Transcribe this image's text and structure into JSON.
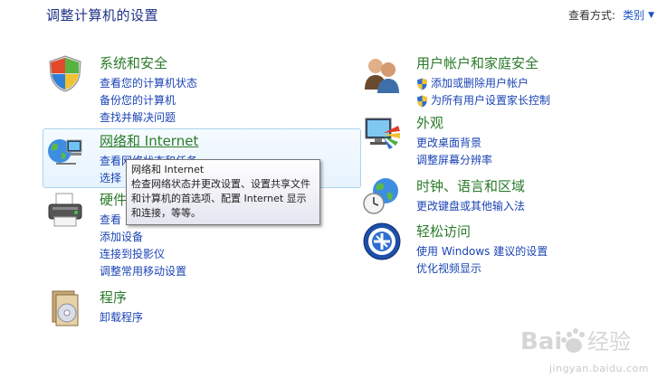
{
  "header": {
    "title": "调整计算机的设置",
    "view_by_label": "查看方式:",
    "view_by_value": "类别"
  },
  "categories": {
    "system": {
      "title": "系统和安全",
      "icon": "shield-windows-icon",
      "links": [
        "查看您的计算机状态",
        "备份您的计算机",
        "查找并解决问题"
      ]
    },
    "network": {
      "title": "网络和 Internet",
      "icon": "network-globe-icon",
      "links": [
        "查看网络状态和任务",
        "选择"
      ]
    },
    "hardware": {
      "title": "硬件",
      "icon": "printer-icon",
      "links": [
        "查看",
        "添加设备",
        "连接到投影仪",
        "调整常用移动设置"
      ]
    },
    "programs": {
      "title": "程序",
      "icon": "programs-disc-icon",
      "links": [
        "卸载程序"
      ]
    },
    "users": {
      "title": "用户帐户和家庭安全",
      "icon": "users-icon",
      "links": [
        "添加或删除用户帐户",
        "为所有用户设置家长控制"
      ]
    },
    "appearance": {
      "title": "外观",
      "icon": "monitor-palette-icon",
      "links": [
        "更改桌面背景",
        "调整屏幕分辨率"
      ]
    },
    "clock": {
      "title": "时钟、语言和区域",
      "icon": "globe-clock-icon",
      "links": [
        "更改键盘或其他输入法"
      ]
    },
    "ease": {
      "title": "轻松访问",
      "icon": "ease-of-access-icon",
      "links": [
        "使用 Windows 建议的设置",
        "优化视频显示"
      ]
    }
  },
  "tooltip": {
    "title": "网络和 Internet",
    "body": "检查网络状态并更改设置、设置共享文件和计算机的首选项、配置 Internet 显示和连接，等等。"
  },
  "watermark": {
    "url": "jingyan.baidu.com"
  },
  "colors": {
    "title_text": "#1e3287",
    "category_title": "#2a7a2a",
    "link": "#1b44b4",
    "hover_border": "#a8d4f0"
  }
}
